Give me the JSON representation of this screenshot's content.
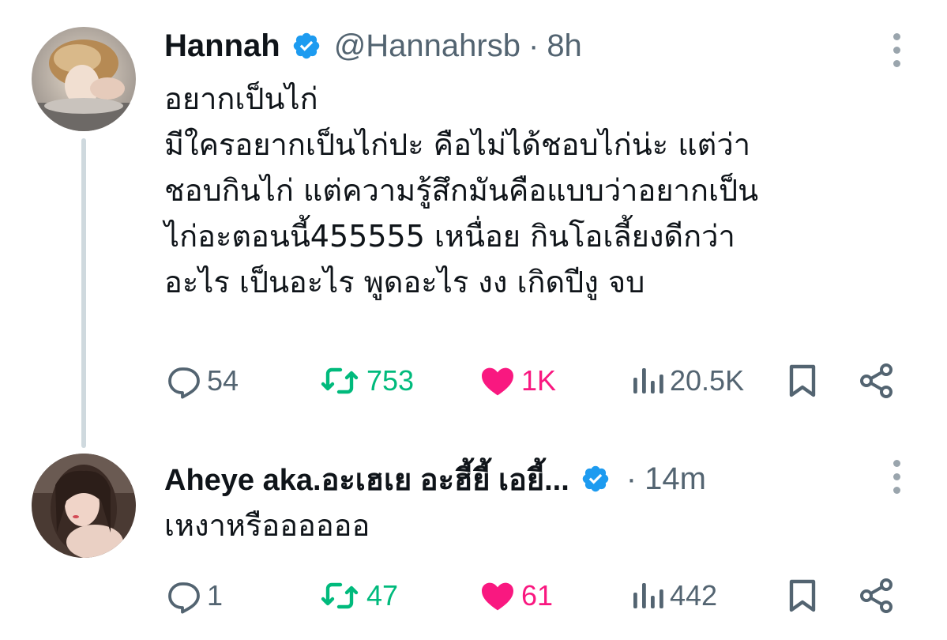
{
  "tweets": [
    {
      "name": "Hannah",
      "handle": "@Hannahrsb",
      "separator": "·",
      "time": "8h",
      "text": "อยากเป็นไก่\nมีใครอยากเป็นไก่ปะ คือไม่ได้ชอบไก่น่ะ แต่ว่า\nชอบกินไก่ แต่ความรู้สึกมันคือแบบว่าอยากเป็น\nไก่อะตอนนี้455555 เหนื่อย กินโอเลี้ยงดีกว่า\nอะไร เป็นอะไร พูดอะไร งง เกิดปีงู จบ",
      "replies": "54",
      "retweets": "753",
      "likes": "1K",
      "views": "20.5K"
    },
    {
      "name": "Aheye aka.อะเฮเย อะฮี้ยี้ เอยี้...",
      "handle": "",
      "separator": "·",
      "time": "14m",
      "text": "เหงาหรืออออออ",
      "replies": "1",
      "retweets": "47",
      "likes": "61",
      "views": "442"
    }
  ],
  "colors": {
    "text": "#0f1419",
    "secondary": "#536471",
    "verified": "#1d9bf0",
    "retweet": "#00ba7c",
    "like": "#f91880",
    "thread_line": "#cfd9de"
  },
  "icons": {
    "reply": "reply-icon",
    "retweet": "retweet-icon",
    "like": "heart-icon",
    "views": "views-icon",
    "bookmark": "bookmark-icon",
    "share": "share-icon",
    "more": "more-icon",
    "verified": "verified-badge-icon"
  }
}
